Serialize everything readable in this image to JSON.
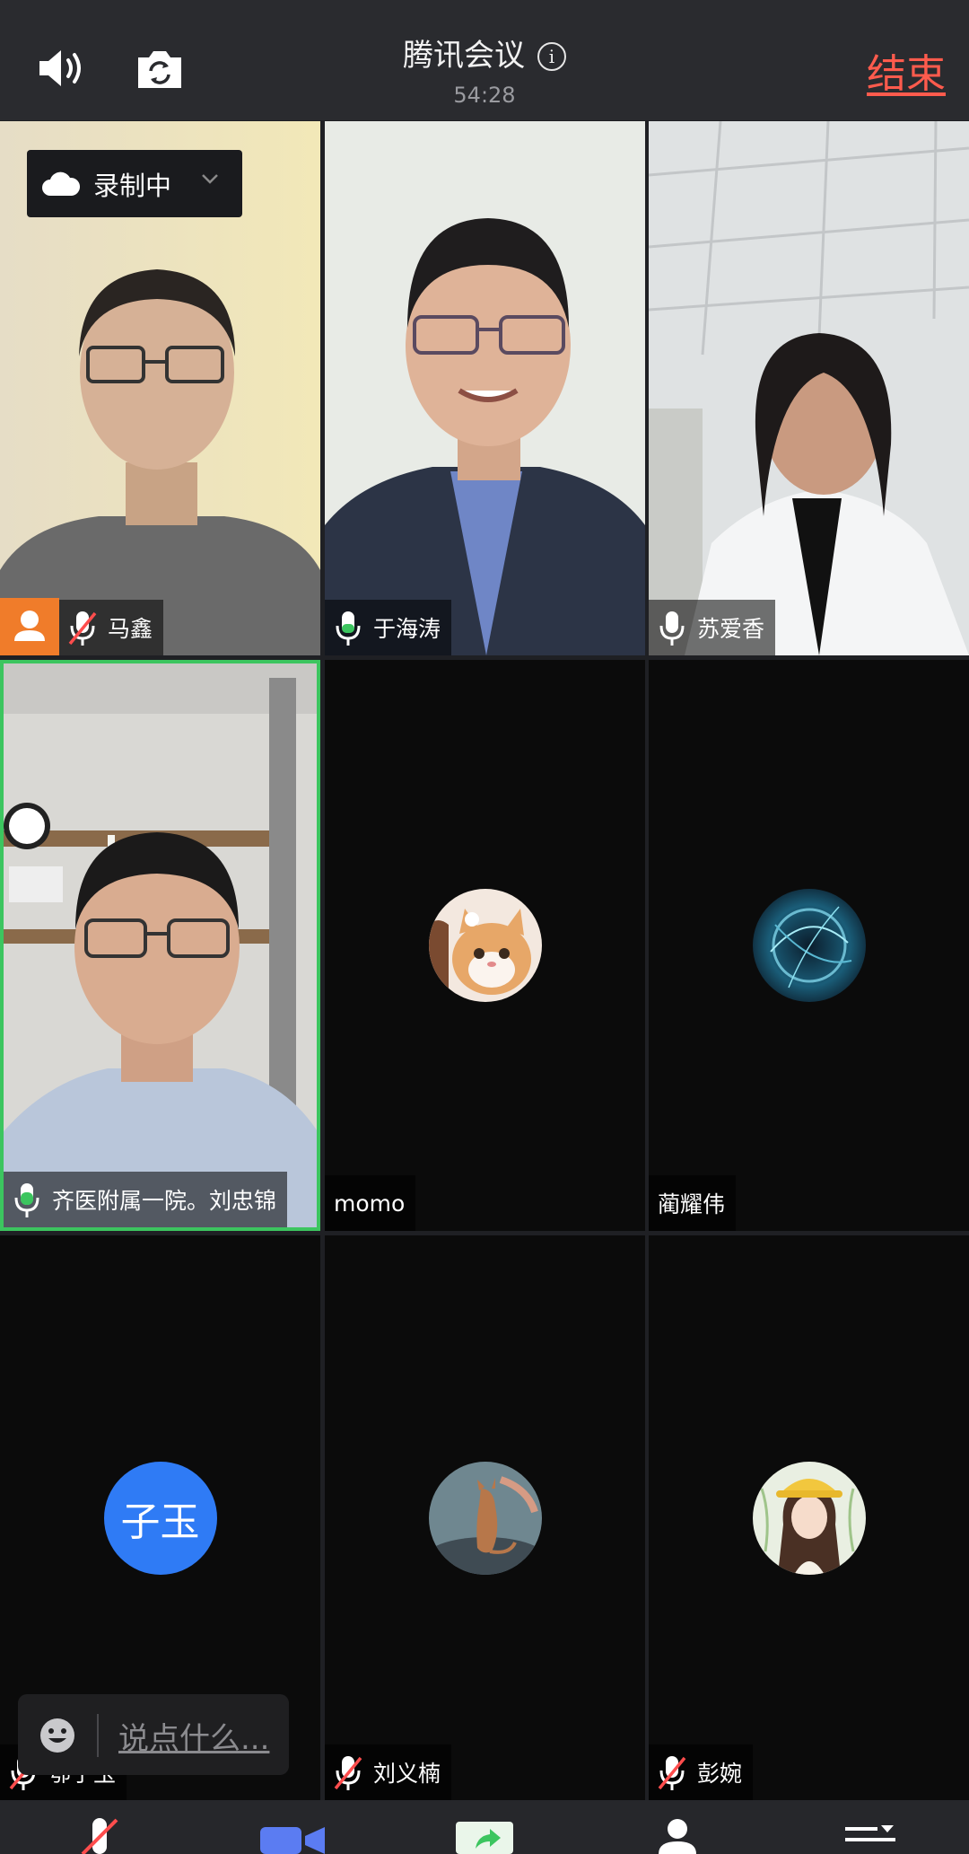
{
  "header": {
    "title": "腾讯会议",
    "info_icon": "i",
    "elapsed": "54:28",
    "end_label": "结束"
  },
  "recording": {
    "label": "录制中"
  },
  "participants": [
    {
      "name": "马鑫",
      "mic": "muted",
      "video": true,
      "host": true
    },
    {
      "name": "于海涛",
      "mic": "on",
      "video": true
    },
    {
      "name": "苏爱香",
      "mic": "on",
      "video": true
    },
    {
      "name": "齐医附属一院。刘忠锦",
      "mic": "on",
      "video": true,
      "speaking": true
    },
    {
      "name": "momo",
      "video": false,
      "avatar": "cat-photo"
    },
    {
      "name": "蔺耀伟",
      "video": false,
      "avatar": "blue-sphere"
    },
    {
      "name": "鄂子玉",
      "mic": "muted",
      "video": false,
      "avatar_text": "子玉"
    },
    {
      "name": "刘义楠",
      "mic": "muted",
      "video": false,
      "avatar": "cat-silhouette"
    },
    {
      "name": "彭婉",
      "mic": "muted",
      "video": false,
      "avatar": "illustrated-girl"
    }
  ],
  "chat": {
    "placeholder": "说点什么..."
  },
  "colors": {
    "end": "#ff5b4d",
    "speaking_border": "#3cc55f",
    "mic_active": "#3cc55f",
    "avatar_blue": "#2f7bf5",
    "host_badge": "#f07c2a"
  }
}
